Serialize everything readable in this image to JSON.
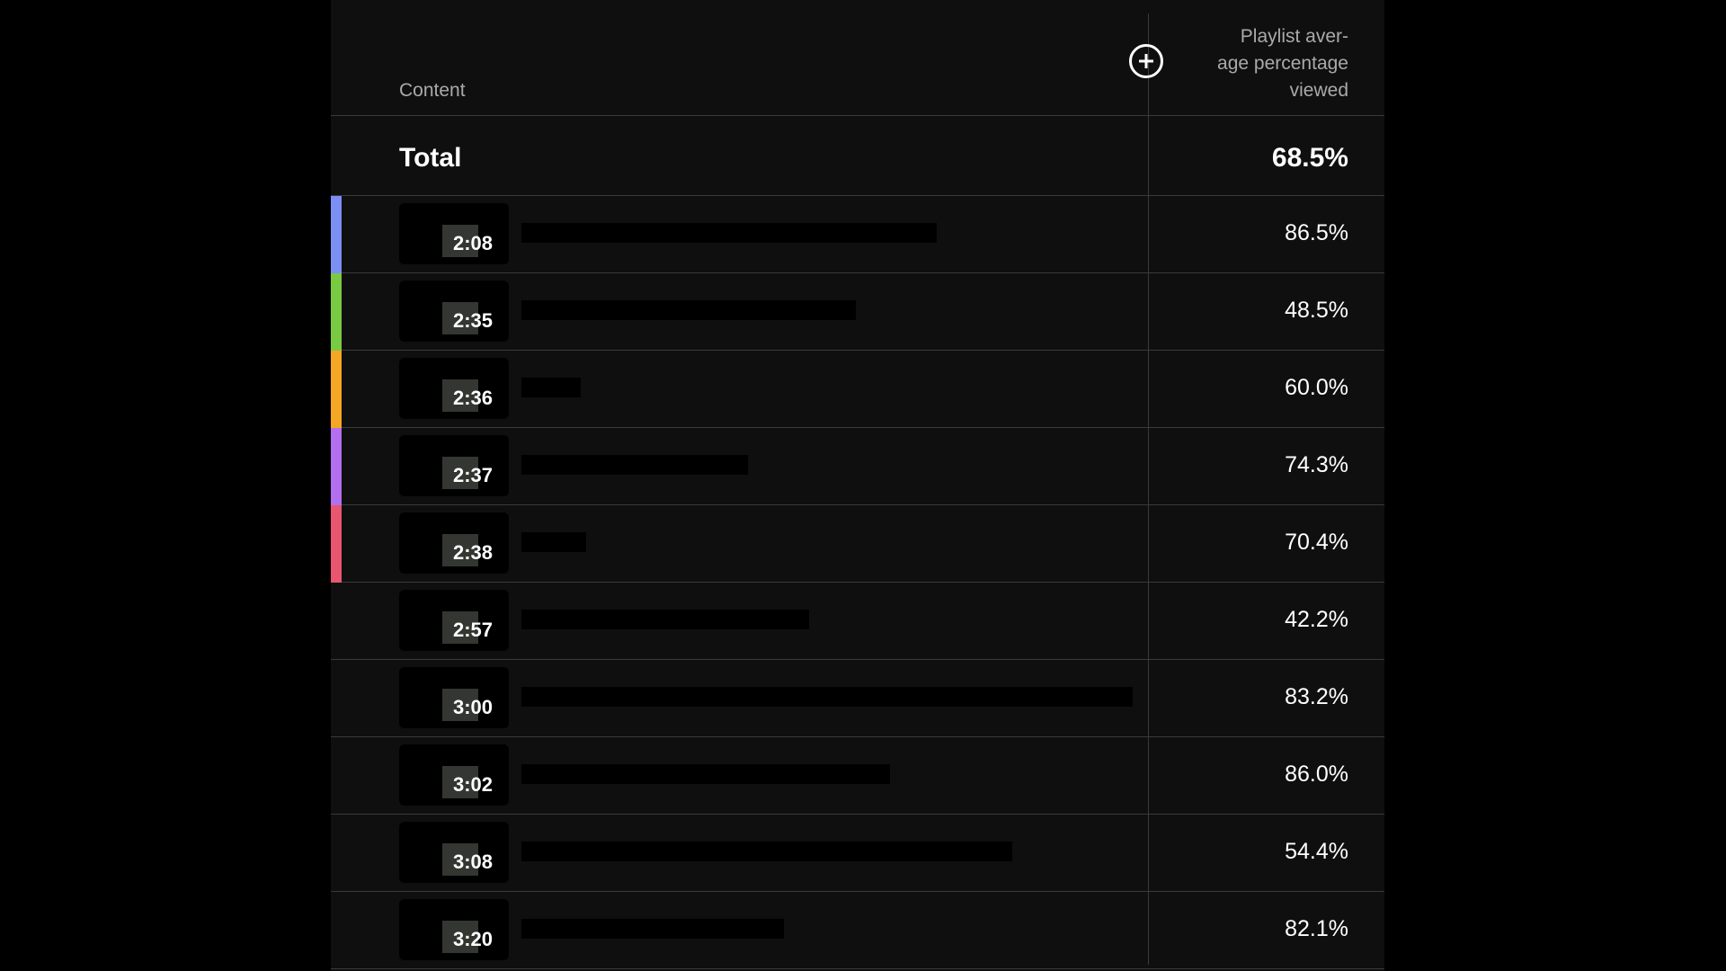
{
  "header": {
    "content_label": "Content",
    "metric_label": "Playlist aver-\nage percentage\nviewed",
    "add_icon": "plus-circle-icon"
  },
  "total": {
    "label": "Total",
    "value": "68.5%"
  },
  "rows": [
    {
      "duration": "2:08",
      "value": "86.5%",
      "color": "#7b8ff5"
    },
    {
      "duration": "2:35",
      "value": "48.5%",
      "color": "#7ac943"
    },
    {
      "duration": "2:36",
      "value": "60.0%",
      "color": "#f5a623"
    },
    {
      "duration": "2:37",
      "value": "74.3%",
      "color": "#b46ef0"
    },
    {
      "duration": "2:38",
      "value": "70.4%",
      "color": "#e8566f"
    },
    {
      "duration": "2:57",
      "value": "42.2%",
      "color": ""
    },
    {
      "duration": "3:00",
      "value": "83.2%",
      "color": ""
    },
    {
      "duration": "3:02",
      "value": "86.0%",
      "color": ""
    },
    {
      "duration": "3:08",
      "value": "54.4%",
      "color": ""
    },
    {
      "duration": "3:20",
      "value": "82.1%",
      "color": ""
    }
  ]
}
